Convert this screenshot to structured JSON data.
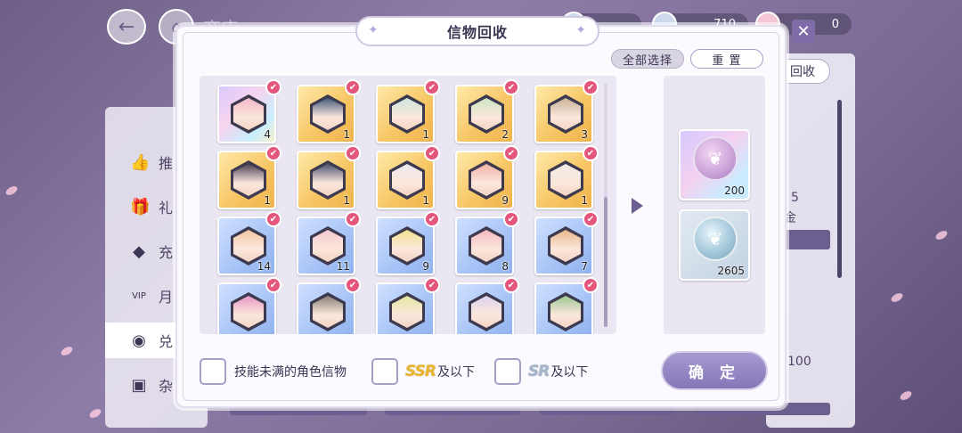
{
  "background": {
    "title": "商店",
    "currencies": [
      {
        "name": "currency-1",
        "value": ""
      },
      {
        "name": "currency-2",
        "value": "710"
      },
      {
        "name": "currency-3",
        "value": "0"
      }
    ],
    "nav": [
      {
        "label": "推",
        "icon": "thumbs-up-icon"
      },
      {
        "label": "礼",
        "icon": "gift-icon"
      },
      {
        "label": "充",
        "icon": "gem-icon"
      },
      {
        "label": "月",
        "icon": "vip-icon"
      },
      {
        "label": "兑",
        "icon": "exchange-icon"
      },
      {
        "label": "杂",
        "icon": "bag-icon"
      }
    ],
    "right_tab": "回收",
    "right_texts": [
      "5",
      "金",
      "100"
    ]
  },
  "modal": {
    "title": "信物回收",
    "select_all_label": "全部选择",
    "reset_label": "重 置",
    "confirm_label": "确 定",
    "cards": [
      {
        "rarity": "rainbow",
        "count": "4",
        "hue": "#f4b6c8"
      },
      {
        "rarity": "gold",
        "count": "1",
        "hue": "#445a7a"
      },
      {
        "rarity": "gold",
        "count": "1",
        "hue": "#cfe6df"
      },
      {
        "rarity": "gold",
        "count": "2",
        "hue": "#cbe6c2"
      },
      {
        "rarity": "gold",
        "count": "3",
        "hue": "#c8b295"
      },
      {
        "rarity": "gold",
        "count": "1",
        "hue": "#4b4054"
      },
      {
        "rarity": "gold",
        "count": "1",
        "hue": "#4c5373"
      },
      {
        "rarity": "gold",
        "count": "1",
        "hue": "#ece9ee"
      },
      {
        "rarity": "gold",
        "count": "9",
        "hue": "#f2b2a8"
      },
      {
        "rarity": "gold",
        "count": "1",
        "hue": "#f0ece6"
      },
      {
        "rarity": "blue",
        "count": "14",
        "hue": "#f6c7a5"
      },
      {
        "rarity": "blue",
        "count": "11",
        "hue": "#f4c9cf"
      },
      {
        "rarity": "blue",
        "count": "9",
        "hue": "#f1e28f"
      },
      {
        "rarity": "blue",
        "count": "8",
        "hue": "#f5b9c2"
      },
      {
        "rarity": "blue",
        "count": "7",
        "hue": "#e7b98b"
      },
      {
        "rarity": "blue",
        "count": "",
        "hue": "#e598c7"
      },
      {
        "rarity": "blue",
        "count": "",
        "hue": "#8a8078"
      },
      {
        "rarity": "blue",
        "count": "",
        "hue": "#e2e7a2"
      },
      {
        "rarity": "blue",
        "count": "",
        "hue": "#ddd4ee"
      },
      {
        "rarity": "blue",
        "count": "",
        "hue": "#9dc792"
      }
    ],
    "rewards": [
      {
        "amount": "200",
        "icon": "purple-coin-icon"
      },
      {
        "amount": "2605",
        "icon": "blue-coin-icon"
      }
    ],
    "filters": [
      {
        "label": "技能未满的角色信物",
        "rarity": "",
        "suffix": ""
      },
      {
        "label": "",
        "rarity": "SSR",
        "suffix": "及以下"
      },
      {
        "label": "",
        "rarity": "SR",
        "suffix": "及以下"
      }
    ]
  },
  "colors": {
    "accent": "#8576b8",
    "check": "#e4567b"
  }
}
